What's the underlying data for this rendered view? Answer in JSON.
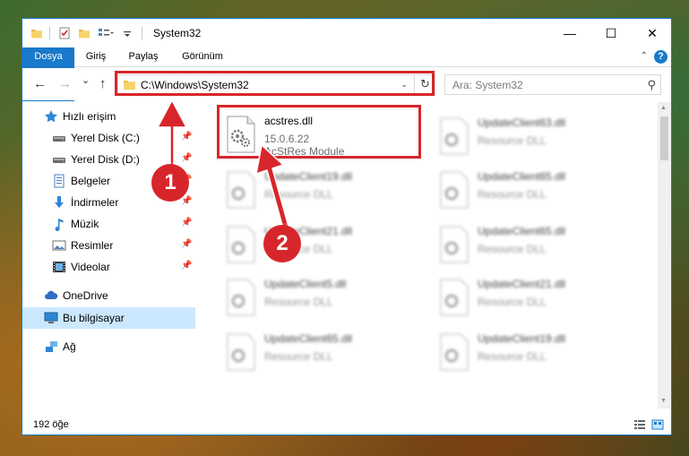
{
  "window": {
    "title": "System32",
    "minimize_glyph": "—",
    "maximize_glyph": "☐",
    "close_glyph": "✕"
  },
  "ribbon": {
    "tabs": [
      {
        "label": "Dosya"
      },
      {
        "label": "Giriş"
      },
      {
        "label": "Paylaş"
      },
      {
        "label": "Görünüm"
      }
    ],
    "help_glyph": "?",
    "collapse_glyph": "⌃"
  },
  "nav": {
    "back_glyph": "←",
    "forward_glyph": "→",
    "recent_glyph": "⌄",
    "up_glyph": "↑",
    "address": "C:\\Windows\\System32",
    "address_dropdown_glyph": "⌄",
    "refresh_glyph": "↻",
    "search_placeholder": "Ara: System32",
    "search_glyph": "⚲"
  },
  "sidebar": {
    "items": [
      {
        "label": "Hızlı erişim",
        "icon": "star-icon",
        "pinned": false
      },
      {
        "label": "Yerel Disk (C:)",
        "icon": "drive-icon",
        "pinned": true
      },
      {
        "label": "Yerel Disk (D:)",
        "icon": "drive-icon",
        "pinned": true
      },
      {
        "label": "Belgeler",
        "icon": "documents-icon",
        "pinned": true
      },
      {
        "label": "İndirmeler",
        "icon": "download-icon",
        "pinned": true
      },
      {
        "label": "Müzik",
        "icon": "music-icon",
        "pinned": true
      },
      {
        "label": "Resimler",
        "icon": "pictures-icon",
        "pinned": true
      },
      {
        "label": "Videolar",
        "icon": "videos-icon",
        "pinned": true
      },
      {
        "label": "OneDrive",
        "icon": "cloud-icon",
        "pinned": false
      },
      {
        "label": "Bu bilgisayar",
        "icon": "computer-icon",
        "pinned": false
      },
      {
        "label": "Ağ",
        "icon": "network-icon",
        "pinned": false
      }
    ],
    "pin_glyph": "📌"
  },
  "files": {
    "featured": {
      "name": "acstres.dll",
      "version": "15.0.6.22",
      "description": "AcStRes Module"
    },
    "left_column": [
      {
        "name": "UpdateClient19.dll",
        "description": "Resource DLL"
      },
      {
        "name": "UpdateClient21.dll",
        "description": "Resource DLL"
      },
      {
        "name": "UpdateClient5.dll",
        "description": "Resource DLL"
      },
      {
        "name": "UpdateClient65.dll",
        "description": "Resource DLL"
      }
    ],
    "right_column": [
      {
        "name": "UpdateClient63.dll",
        "description": "Resource DLL"
      },
      {
        "name": "UpdateClient65.dll",
        "description": "Resource DLL"
      },
      {
        "name": "UpdateClient65.dll",
        "description": "Resource DLL"
      },
      {
        "name": "UpdateClient21.dll",
        "description": "Resource DLL"
      },
      {
        "name": "UpdateClient19.dll",
        "description": "Resource DLL"
      }
    ]
  },
  "status": {
    "item_count": "192 öğe"
  },
  "annotations": {
    "step1": "1",
    "step2": "2",
    "highlight_color": "#d7262b"
  },
  "colors": {
    "accent": "#1979ca",
    "selection": "#cce8ff"
  }
}
